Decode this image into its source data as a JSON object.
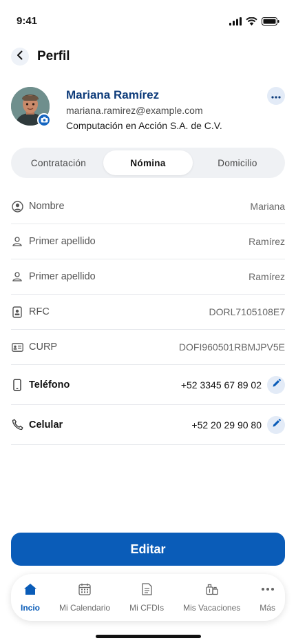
{
  "status_bar": {
    "time": "9:41"
  },
  "header": {
    "title": "Perfil"
  },
  "profile": {
    "name": "Mariana Ramírez",
    "email": "mariana.ramirez@example.com",
    "company": "Computación en Acción S.A. de C.V."
  },
  "tabs": [
    {
      "label": "Contratación"
    },
    {
      "label": "Nómina"
    },
    {
      "label": "Domicilio"
    }
  ],
  "fields": [
    {
      "label": "Nombre",
      "value": "Mariana",
      "icon": "user-circle-icon"
    },
    {
      "label": "Primer apellido",
      "value": "Ramírez",
      "icon": "user-outline-icon"
    },
    {
      "label": "Primer apellido",
      "value": "Ramírez",
      "icon": "user-outline-icon"
    },
    {
      "label": "RFC",
      "value": "DORL7105108E7",
      "icon": "badge-icon"
    },
    {
      "label": "CURP",
      "value": "DOFI960501RBMJPV5E",
      "icon": "id-card-icon"
    },
    {
      "label": "Teléfono",
      "value": "+52 3345 67 89 02",
      "icon": "phone-icon"
    },
    {
      "label": "Celular",
      "value": "+52 20 29 90 80",
      "icon": "handset-icon"
    }
  ],
  "primary_button": {
    "label": "Editar"
  },
  "bottom_nav": [
    {
      "label": "Incio",
      "icon": "home-icon"
    },
    {
      "label": "Mi Calendario",
      "icon": "calendar-icon"
    },
    {
      "label": "Mi CFDIs",
      "icon": "document-icon"
    },
    {
      "label": "Mis Vacaciones",
      "icon": "luggage-icon"
    },
    {
      "label": "Más",
      "icon": "more-dots-icon"
    }
  ],
  "colors": {
    "brand": "#0a5cb8",
    "name": "#0d3b7a",
    "accent_bg": "#e3ebf7"
  }
}
